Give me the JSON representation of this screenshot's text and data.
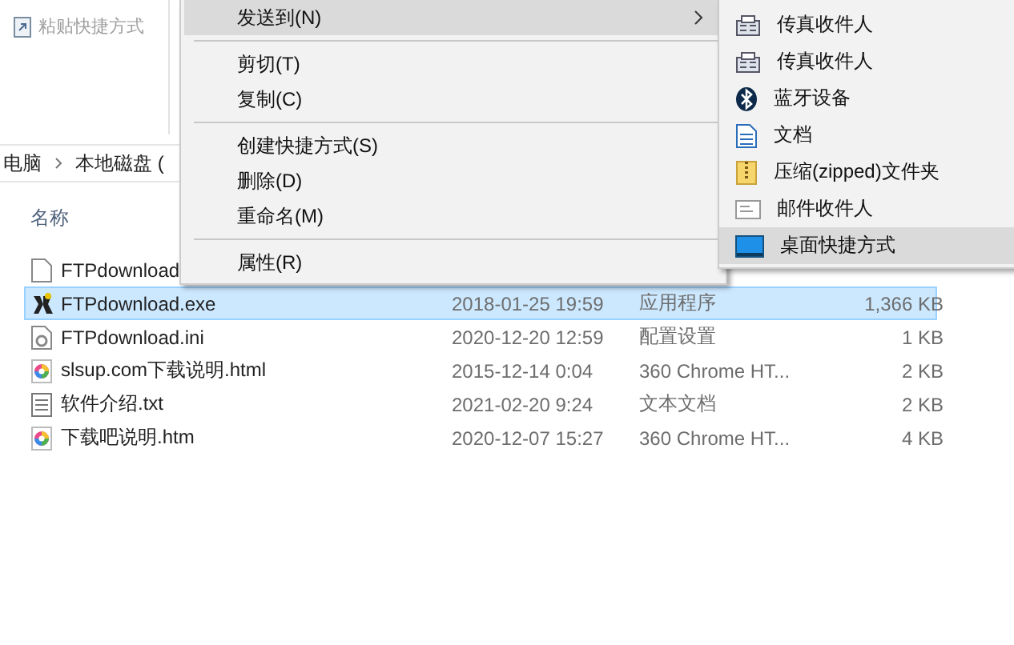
{
  "ribbon": {
    "items": [
      {
        "label": "粘贴快捷方式",
        "disabled": true
      }
    ]
  },
  "breadcrumb": [
    "电脑",
    "本地磁盘 ("
  ],
  "file_list": {
    "columns": [
      {
        "label": "名称"
      }
    ],
    "rows": [
      {
        "kind": "blank",
        "name": "FTPdownload",
        "selected": false
      },
      {
        "kind": "exe",
        "name": "FTPdownload.exe",
        "date": "2018-01-25 19:59",
        "type": "应用程序",
        "size": "1,366 KB",
        "selected": true
      },
      {
        "kind": "ini",
        "name": "FTPdownload.ini",
        "date": "2020-12-20 12:59",
        "type": "配置设置",
        "size": "1 KB",
        "selected": false
      },
      {
        "kind": "html",
        "name": "slsup.com下载说明.html",
        "date": "2015-12-14 0:04",
        "type": "360 Chrome HT...",
        "size": "2 KB",
        "selected": false
      },
      {
        "kind": "txt",
        "name": "软件介绍.txt",
        "date": "2021-02-20 9:24",
        "type": "文本文档",
        "size": "2 KB",
        "selected": false
      },
      {
        "kind": "html",
        "name": "下载吧说明.htm",
        "date": "2020-12-07 15:27",
        "type": "360 Chrome HT...",
        "size": "4 KB",
        "selected": false
      }
    ]
  },
  "context_menu": {
    "items": [
      {
        "kind": "item",
        "label": "发送到(N)",
        "highlighted": true,
        "submenu": true
      },
      {
        "kind": "separator"
      },
      {
        "kind": "item",
        "label": "剪切(T)",
        "highlighted": false,
        "submenu": false
      },
      {
        "kind": "item",
        "label": "复制(C)",
        "highlighted": false,
        "submenu": false
      },
      {
        "kind": "separator"
      },
      {
        "kind": "item",
        "label": "创建快捷方式(S)",
        "highlighted": false,
        "submenu": false
      },
      {
        "kind": "item",
        "label": "删除(D)",
        "highlighted": false,
        "submenu": false
      },
      {
        "kind": "item",
        "label": "重命名(M)",
        "highlighted": false,
        "submenu": false
      },
      {
        "kind": "separator"
      },
      {
        "kind": "item",
        "label": "属性(R)",
        "highlighted": false,
        "submenu": false
      }
    ]
  },
  "submenu": {
    "items": [
      {
        "kind": "fax",
        "label": "传真收件人",
        "highlighted": false
      },
      {
        "kind": "fax",
        "label": "传真收件人",
        "highlighted": false
      },
      {
        "kind": "bluetooth",
        "label": "蓝牙设备",
        "highlighted": false
      },
      {
        "kind": "document",
        "label": "文档",
        "highlighted": false
      },
      {
        "kind": "zip",
        "label": "压缩(zipped)文件夹",
        "highlighted": false
      },
      {
        "kind": "mail",
        "label": "邮件收件人",
        "highlighted": false
      },
      {
        "kind": "desktop",
        "label": "桌面快捷方式",
        "highlighted": true
      }
    ]
  }
}
